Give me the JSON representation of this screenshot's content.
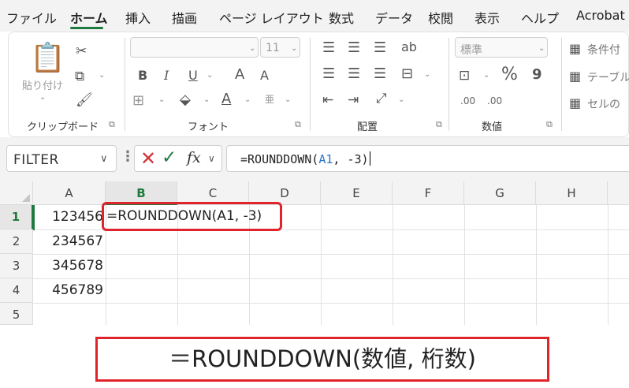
{
  "menu": {
    "tabs": [
      "ファイル",
      "ホーム",
      "挿入",
      "描画",
      "ページ レイアウト",
      "数式",
      "データ",
      "校閲",
      "表示",
      "ヘルプ",
      "Acrobat"
    ],
    "active": "ホーム"
  },
  "ribbon": {
    "clipboard": {
      "label": "クリップボード",
      "paste_label": "貼り付け"
    },
    "font": {
      "label": "フォント",
      "size": "11",
      "bold": "B",
      "italic": "I",
      "underline": "U",
      "grow": "A",
      "shrink": "A"
    },
    "alignment": {
      "label": "配置"
    },
    "number": {
      "label": "数値",
      "format": "標準",
      "percent": "%",
      "comma": "9",
      "inc_decimal": ".00",
      "dec_decimal": ".00"
    },
    "styles": {
      "conditional": "条件付",
      "table": "テーブル",
      "cell": "セルの"
    }
  },
  "formula_bar": {
    "name_box": "FILTER",
    "formula_prefix": "=ROUNDDOWN(",
    "formula_ref": "A1",
    "formula_suffix": ", -3)"
  },
  "grid": {
    "columns": [
      "A",
      "B",
      "C",
      "D",
      "E",
      "F",
      "G",
      "H"
    ],
    "rows": [
      "1",
      "2",
      "3",
      "4",
      "5"
    ],
    "a_values": [
      "123456",
      "234567",
      "345678",
      "456789",
      ""
    ],
    "b1_edit": "=ROUNDDOWN(A1, -3)",
    "selected_column": "B",
    "selected_row": "1"
  },
  "caption": {
    "syntax": "＝ROUNDDOWN(数値, 桁数)"
  },
  "colors": {
    "accent_green": "#1f7a3f",
    "highlight_red": "#e0242b",
    "ref_blue": "#2e75c4"
  }
}
